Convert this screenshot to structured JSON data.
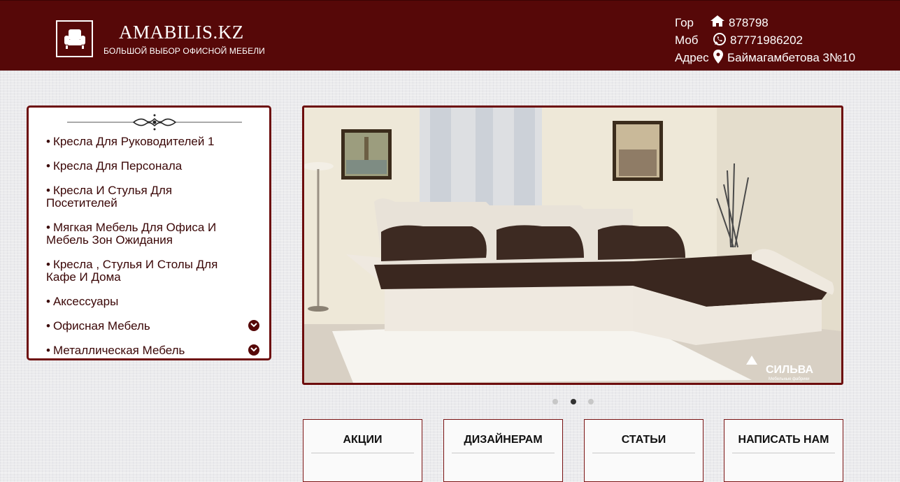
{
  "header": {
    "brand": "AMABILIS.KZ",
    "tagline": "БОЛЬШОЙ ВЫБОР ОФИСНОЙ МЕБЕЛИ",
    "logo_icon": "armchair-icon",
    "contacts": [
      {
        "label": "Гор",
        "icon": "home-icon",
        "value": "878798"
      },
      {
        "label": "Моб",
        "icon": "whatsapp-icon",
        "value": "87771986202"
      },
      {
        "label": "Адрес",
        "icon": "map-marker-icon",
        "value": "Баймагамбетова 3№10"
      }
    ]
  },
  "sidebar": {
    "items": [
      {
        "label": "Кресла Для Руководителей 1"
      },
      {
        "label": "Кресла Для Персонала"
      },
      {
        "label": "Кресла И Стулья Для Посетителей"
      },
      {
        "label": "Мягкая Мебель Для Офиса И Мебель Зон Ожидания"
      },
      {
        "label": "Кресла , Стулья И Столы Для Кафе И Дома"
      },
      {
        "label": "Аксессуары"
      },
      {
        "label": "Офисная Мебель",
        "expandable": true
      },
      {
        "label": "Металлическая Мебель",
        "expandable": true
      }
    ]
  },
  "slider": {
    "watermark": "СИЛЬВА",
    "watermark_sub": "Мебельные фабрики",
    "slide_count": 3,
    "active_index": 1
  },
  "cards": [
    {
      "title": "АКЦИИ"
    },
    {
      "title": "ДИЗАЙНЕРАМ"
    },
    {
      "title": "СТАТЬИ"
    },
    {
      "title": "НАПИСАТЬ НАМ"
    }
  ],
  "colors": {
    "brand": "#560808",
    "accent_border": "#6d0d0d",
    "menu_text": "#3a0606"
  }
}
